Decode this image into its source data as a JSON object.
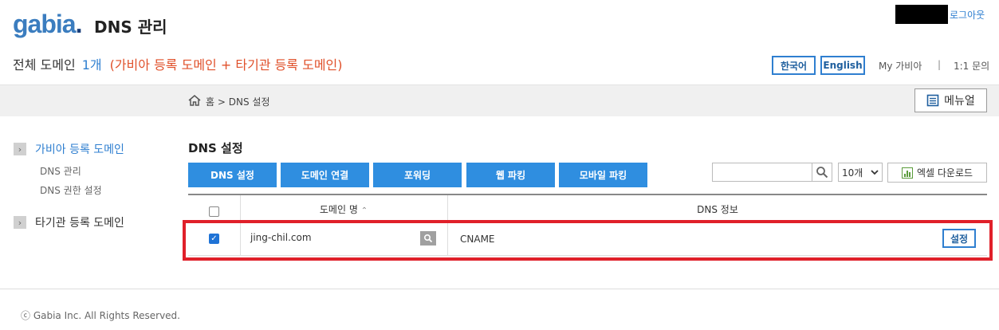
{
  "header": {
    "logo_text": "gabia",
    "logo_dot": ".",
    "app_title": "DNS 관리",
    "logout": "로그아웃"
  },
  "summary": {
    "label": "전체 도메인",
    "count": "1개",
    "desc": "(가비아 등록 도메인 + 타기관 등록 도메인)"
  },
  "topnav": {
    "korean": "한국어",
    "english": "English",
    "my_gabia": "My 가비아",
    "separator": "|",
    "qa": "1:1 문의"
  },
  "breadcrumb": {
    "home": "홈",
    "sep": ">",
    "current": "DNS 설정"
  },
  "menu_button": "메뉴얼",
  "sidebar": {
    "items": [
      {
        "label": "가비아 등록 도메인",
        "active": true,
        "children": [
          "DNS 관리",
          "DNS 권한 설정"
        ]
      },
      {
        "label": "타기관 등록 도메인",
        "active": false,
        "children": []
      }
    ]
  },
  "main": {
    "title": "DNS 설정",
    "actions": [
      "DNS 설정",
      "도메인 연결",
      "포워딩",
      "웹 파킹",
      "모바일 파킹"
    ],
    "search_placeholder": "",
    "page_size": "10개",
    "excel": "엑셀 다운로드"
  },
  "table": {
    "columns": [
      "도메인 명",
      "DNS 정보"
    ],
    "sort_indicator": "⌃",
    "rows": [
      {
        "checked": true,
        "domain": "jing-chil.com",
        "dns": "CNAME",
        "action": "설정"
      }
    ]
  },
  "footer": {
    "copyright": "ⓒ Gabia Inc. All Rights Reserved."
  },
  "colors": {
    "accent": "#2f7fd0",
    "button": "#2f8ee0",
    "highlight": "#e0202a",
    "orange_text": "#e0502a"
  }
}
